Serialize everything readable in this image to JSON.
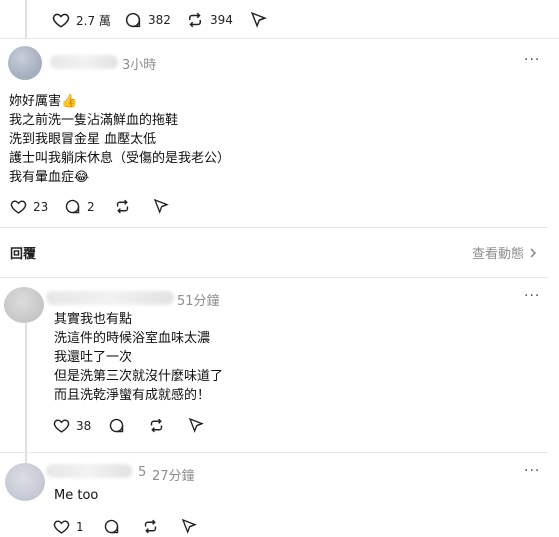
{
  "top_actions": {
    "likes": "2.7 萬",
    "comments": "382",
    "reposts": "394"
  },
  "post1": {
    "time": "3小時",
    "lines": [
      "妳好厲害👍",
      "我之前洗一隻沾滿鮮血的拖鞋",
      "洗到我眼冒金星 血壓太低",
      "護士叫我躺床休息（受傷的是我老公）",
      "我有暈血症😂"
    ],
    "likes": "23",
    "comments": "2"
  },
  "reply_bar": {
    "label": "回覆",
    "view_activity": "查看動態"
  },
  "post2": {
    "time": "51分鐘",
    "lines": [
      "其實我也有點",
      "洗這件的時候浴室血味太濃",
      "我還吐了一次",
      "但是洗第三次就沒什麼味道了",
      "而且洗乾淨蠻有成就感的！"
    ],
    "likes": "38"
  },
  "post3": {
    "name_suffix": "5",
    "time": "27分鐘",
    "lines": [
      "Me too"
    ],
    "likes": "1"
  }
}
